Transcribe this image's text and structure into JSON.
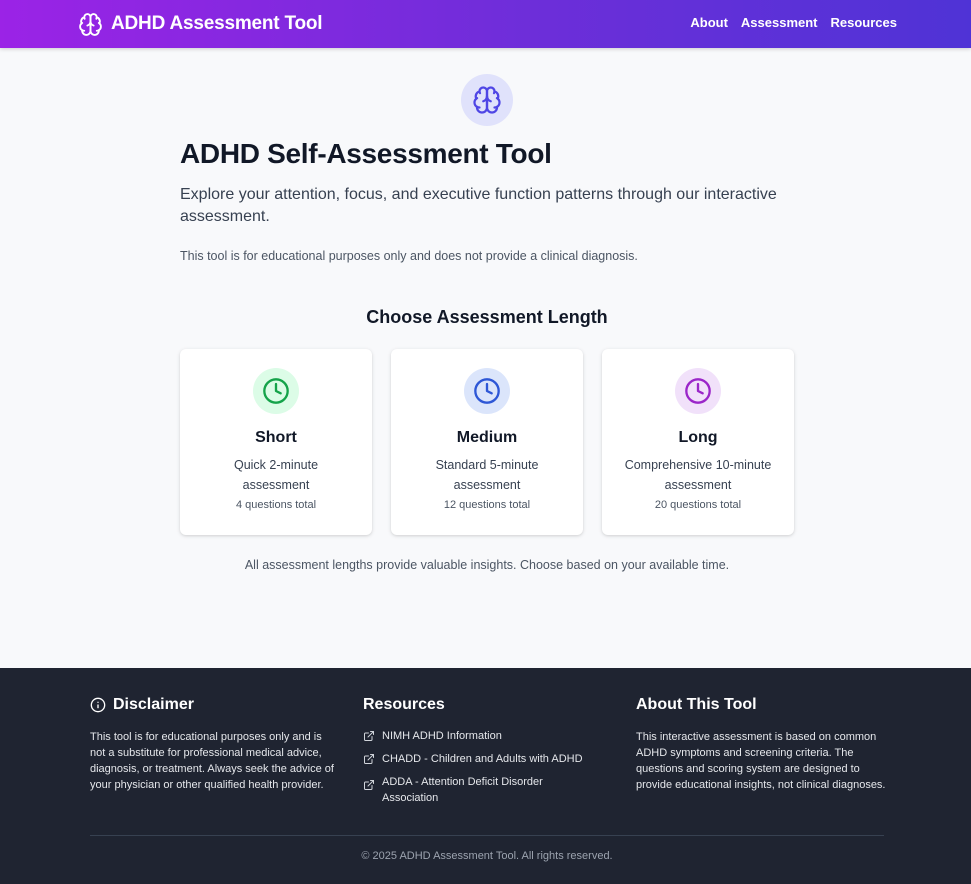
{
  "nav": {
    "brand": "ADHD Assessment Tool",
    "links": [
      "About",
      "Assessment",
      "Resources"
    ]
  },
  "hero": {
    "icon": "brain-icon",
    "title": "ADHD Self-Assessment Tool",
    "subtitle": "Explore your attention, focus, and executive function patterns through our interactive assessment.",
    "note": "This tool is for educational purposes only and does not provide a clinical diagnosis."
  },
  "assessment": {
    "heading": "Choose Assessment Length",
    "options": [
      {
        "name": "Short",
        "description": "Quick 2-minute assessment",
        "count": "4 questions total",
        "icon": "clock-icon",
        "accent": "#15a34a",
        "bg": "#dcfce7"
      },
      {
        "name": "Medium",
        "description": "Standard 5-minute assessment",
        "count": "12 questions total",
        "icon": "clock-icon",
        "accent": "#2e57d6",
        "bg": "#dbe5fb"
      },
      {
        "name": "Long",
        "description": "Comprehensive 10-minute assessment",
        "count": "20 questions total",
        "icon": "clock-icon",
        "accent": "#9b26c9",
        "bg": "#f1e1fa"
      }
    ],
    "note": "All assessment lengths provide valuable insights. Choose based on your available time."
  },
  "footer": {
    "disclaimer": {
      "title": "Disclaimer",
      "icon": "info-icon",
      "body": "This tool is for educational purposes only and is not a substitute for professional medical advice, diagnosis, or treatment. Always seek the advice of your physician or other qualified health provider."
    },
    "resources": {
      "title": "Resources",
      "links": [
        "NIMH ADHD Information",
        "CHADD - Children and Adults with ADHD",
        "ADDA - Attention Deficit Disorder Association"
      ]
    },
    "about": {
      "title": "About This Tool",
      "body": "This interactive assessment is based on common ADHD symptoms and screening criteria. The questions and scoring system are designed to provide educational insights, not clinical diagnoses."
    },
    "copyright": "© 2025 ADHD Assessment Tool. All rights reserved."
  },
  "colors": {
    "nav_gradient_start": "#9b23e6",
    "nav_gradient_end": "#4f33d6",
    "brand_accent": "#4f46e5",
    "footer_bg": "#1f2431",
    "page_bg": "#f8f9fb"
  }
}
